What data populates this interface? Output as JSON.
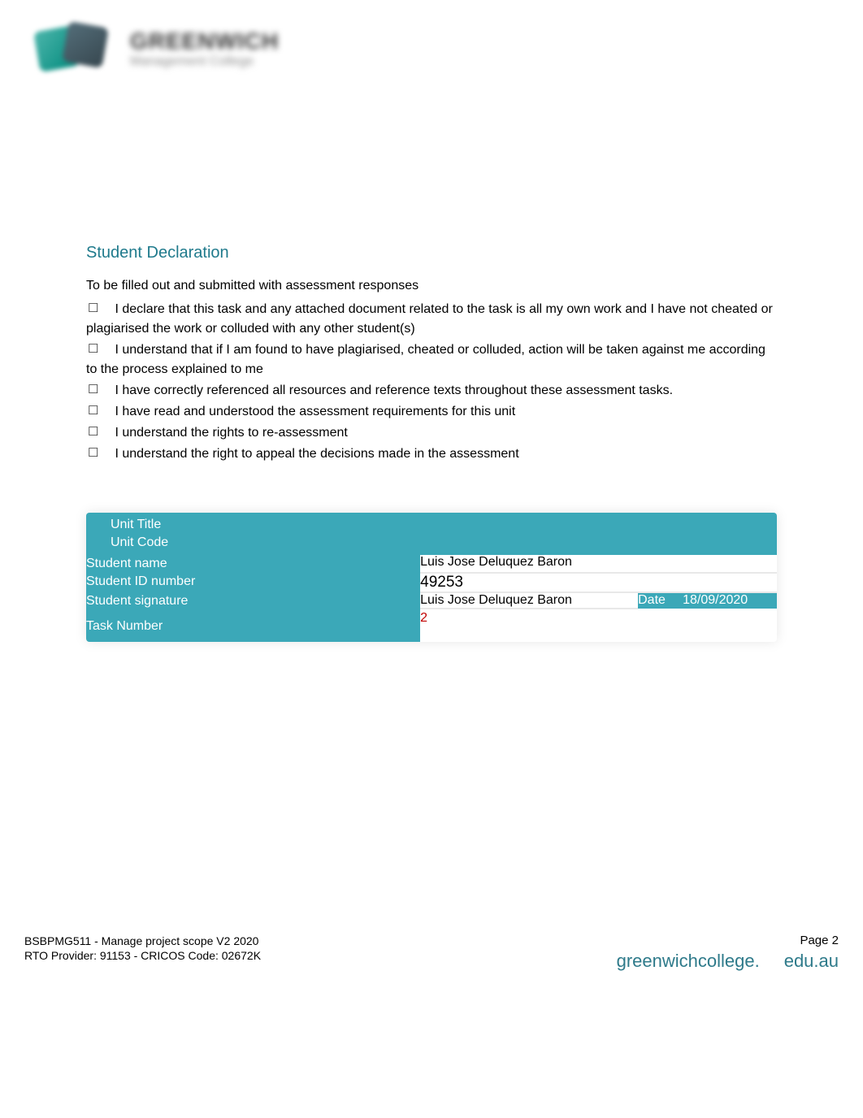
{
  "logo": {
    "title": "GREENWICH",
    "subtitle": "Management College"
  },
  "declaration": {
    "heading": "Student Declaration",
    "intro": "To be filled out and submitted with assessment responses",
    "items": [
      "I declare that this task and any attached document related to the task is all my own work and I have not cheated or plagiarised the work or colluded with any other student(s)",
      "I understand that if I am found to have plagiarised, cheated or colluded, action will be taken against me according to the process explained to me",
      "I have correctly referenced all resources and reference texts throughout these assessment tasks.",
      "I have read and understood the assessment requirements for this unit",
      "I understand the rights to re-assessment",
      "I understand the right to appeal the decisions made in the assessment"
    ]
  },
  "form": {
    "labels": {
      "unit_title": "Unit Title",
      "unit_code": "Unit Code",
      "student_name": "Student name",
      "student_id": "Student ID number",
      "student_signature": "Student signature",
      "date": "Date",
      "task_number": "Task Number"
    },
    "values": {
      "unit_title": "",
      "unit_code": "",
      "student_name": "Luis Jose Deluquez Baron",
      "student_id": "49253",
      "student_signature": "Luis Jose Deluquez Baron",
      "date": "18/09/2020",
      "task_number": "2"
    }
  },
  "footer": {
    "doc_title": "BSBPMG511 - Manage project scope V2 2020",
    "provider": "RTO Provider: 91153        - CRICOS    Code: 02672K",
    "page": "Page 2",
    "website_part1": "greenwichcollege.",
    "website_part2": "edu.au"
  }
}
